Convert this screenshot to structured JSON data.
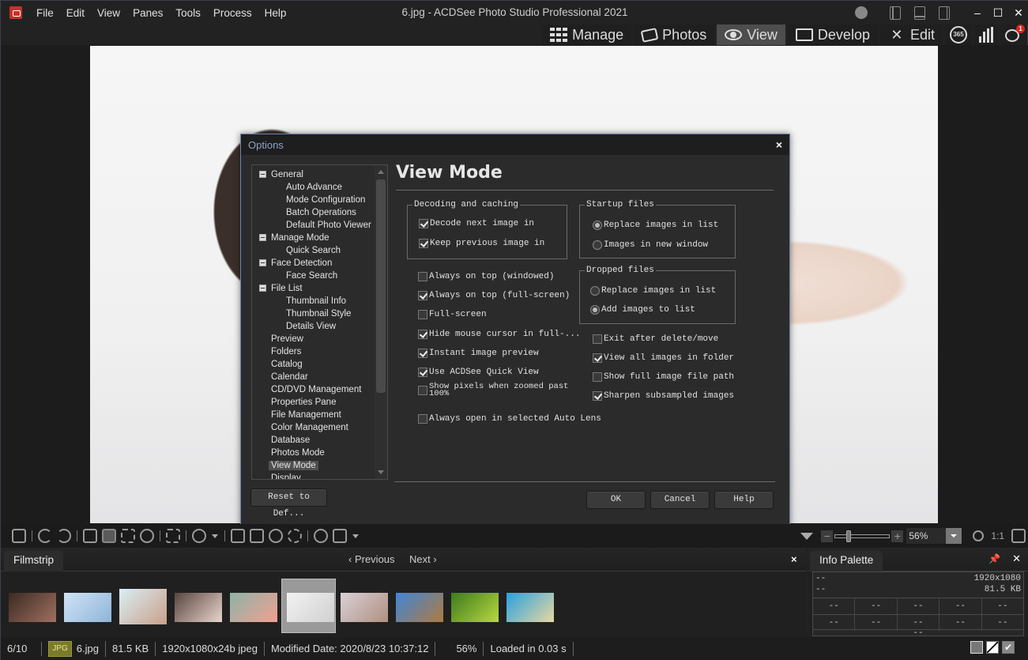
{
  "app": {
    "title": "6.jpg - ACDSee Photo Studio Professional 2021",
    "menu": [
      "File",
      "Edit",
      "View",
      "Panes",
      "Tools",
      "Process",
      "Help"
    ],
    "modes": [
      {
        "label": "Manage",
        "icon": "grid-icon",
        "active": false
      },
      {
        "label": "Photos",
        "icon": "photos-icon",
        "active": false
      },
      {
        "label": "View",
        "icon": "eye-icon",
        "active": true
      },
      {
        "label": "Develop",
        "icon": "develop-icon",
        "active": false
      },
      {
        "label": "Edit",
        "icon": "edit-icon",
        "active": false
      }
    ],
    "badge_365": "365",
    "notification_count": "1"
  },
  "dialog": {
    "title": "Options",
    "close": "×",
    "heading": "View Mode",
    "tree": [
      {
        "label": "General",
        "level": 0,
        "expander": true
      },
      {
        "label": "Auto Advance",
        "level": 1
      },
      {
        "label": "Mode Configuration",
        "level": 1
      },
      {
        "label": "Batch Operations",
        "level": 1
      },
      {
        "label": "Default Photo Viewer",
        "level": 1
      },
      {
        "label": "Manage Mode",
        "level": 0,
        "expander": true
      },
      {
        "label": "Quick Search",
        "level": 1
      },
      {
        "label": "Face Detection",
        "level": 0,
        "expander": true
      },
      {
        "label": "Face Search",
        "level": 1
      },
      {
        "label": "File List",
        "level": 0,
        "expander": true
      },
      {
        "label": "Thumbnail Info",
        "level": 1
      },
      {
        "label": "Thumbnail Style",
        "level": 1
      },
      {
        "label": "Details View",
        "level": 1
      },
      {
        "label": "Preview",
        "level": 0
      },
      {
        "label": "Folders",
        "level": 0
      },
      {
        "label": "Catalog",
        "level": 0
      },
      {
        "label": "Calendar",
        "level": 0
      },
      {
        "label": "CD/DVD Management",
        "level": 0
      },
      {
        "label": "Properties Pane",
        "level": 0
      },
      {
        "label": "File Management",
        "level": 0
      },
      {
        "label": "Color Management",
        "level": 0
      },
      {
        "label": "Database",
        "level": 0
      },
      {
        "label": "Photos Mode",
        "level": 0
      },
      {
        "label": "View Mode",
        "level": 0,
        "selected": true
      },
      {
        "label": "Display",
        "level": 0
      }
    ],
    "decoding": {
      "legend": "Decoding and caching",
      "options": [
        {
          "label": "Decode next image in",
          "checked": true
        },
        {
          "label": "Keep previous image in",
          "checked": true
        }
      ]
    },
    "startup": {
      "legend": "Startup files",
      "options": [
        {
          "label": "Replace images in list",
          "selected": true
        },
        {
          "label": "Images in new window",
          "selected": false
        }
      ]
    },
    "dropped": {
      "legend": "Dropped files",
      "options": [
        {
          "label": "Replace images in list",
          "selected": false
        },
        {
          "label": "Add images to list",
          "selected": true
        }
      ]
    },
    "left_checks": [
      {
        "label": "Always on top (windowed)",
        "checked": false
      },
      {
        "label": "Always on top (full-screen)",
        "checked": true
      },
      {
        "label": "Full-screen",
        "checked": false
      },
      {
        "label": "Hide mouse cursor in full-...",
        "checked": true
      },
      {
        "label": "Instant image preview",
        "checked": true
      },
      {
        "label": "Use ACDSee Quick View",
        "checked": true
      },
      {
        "label": "Show pixels when zoomed past 100%",
        "checked": false
      },
      {
        "label": "Always open in selected Auto Lens",
        "checked": false
      }
    ],
    "right_checks": [
      {
        "label": "Exit after delete/move",
        "checked": false
      },
      {
        "label": "View all images in folder",
        "checked": true
      },
      {
        "label": "Show full image file path",
        "checked": false
      },
      {
        "label": "Sharpen subsampled images",
        "checked": true
      }
    ],
    "reset_label": "Reset to Def...",
    "ok_label": "OK",
    "cancel_label": "Cancel",
    "help_label": "Help"
  },
  "zoom": {
    "value": "56%",
    "one_to_one": "1:1"
  },
  "filmstrip": {
    "tab": "Filmstrip",
    "previous": "Previous",
    "next": "Next",
    "close": "×",
    "thumbnails": [
      {
        "name": "thumb-1",
        "colors": [
          "#3c2a22",
          "#a07060"
        ]
      },
      {
        "name": "thumb-2",
        "colors": [
          "#cfe3f7",
          "#8fb5d8"
        ]
      },
      {
        "name": "thumb-3",
        "colors": [
          "#d9eef5",
          "#c9a089"
        ]
      },
      {
        "name": "thumb-4",
        "colors": [
          "#5a4540",
          "#e8d6cc"
        ]
      },
      {
        "name": "thumb-5",
        "colors": [
          "#8fb3a8",
          "#f0a090"
        ]
      },
      {
        "name": "thumb-6",
        "colors": [
          "#f2f2f2",
          "#d0d0d0"
        ],
        "selected": true
      },
      {
        "name": "thumb-7",
        "colors": [
          "#d8d0d8",
          "#b09080"
        ]
      },
      {
        "name": "thumb-8",
        "colors": [
          "#3f86d8",
          "#b07a40"
        ]
      },
      {
        "name": "thumb-9",
        "colors": [
          "#3e7a20",
          "#b8d840"
        ]
      },
      {
        "name": "thumb-10",
        "colors": [
          "#2aa0e0",
          "#e8d8a0"
        ]
      }
    ]
  },
  "info_palette": {
    "tab": "Info Palette",
    "line1_left": "--",
    "line2_left": "--",
    "dimensions": "1920x1080",
    "size": "81.5 KB",
    "row1": [
      "--",
      "--",
      "--",
      "--",
      "--"
    ],
    "row2": [
      "--",
      "--",
      "--",
      "--",
      "--"
    ],
    "row3": "--"
  },
  "status": {
    "position": "6/10",
    "format": "JPG",
    "filename": "6.jpg",
    "filesize": "81.5 KB",
    "dims": "1920x1080x24b jpeg",
    "modified": "Modified Date: 2020/8/23 10:37:12",
    "zoom": "56%",
    "loaded": "Loaded in 0.03 s"
  }
}
